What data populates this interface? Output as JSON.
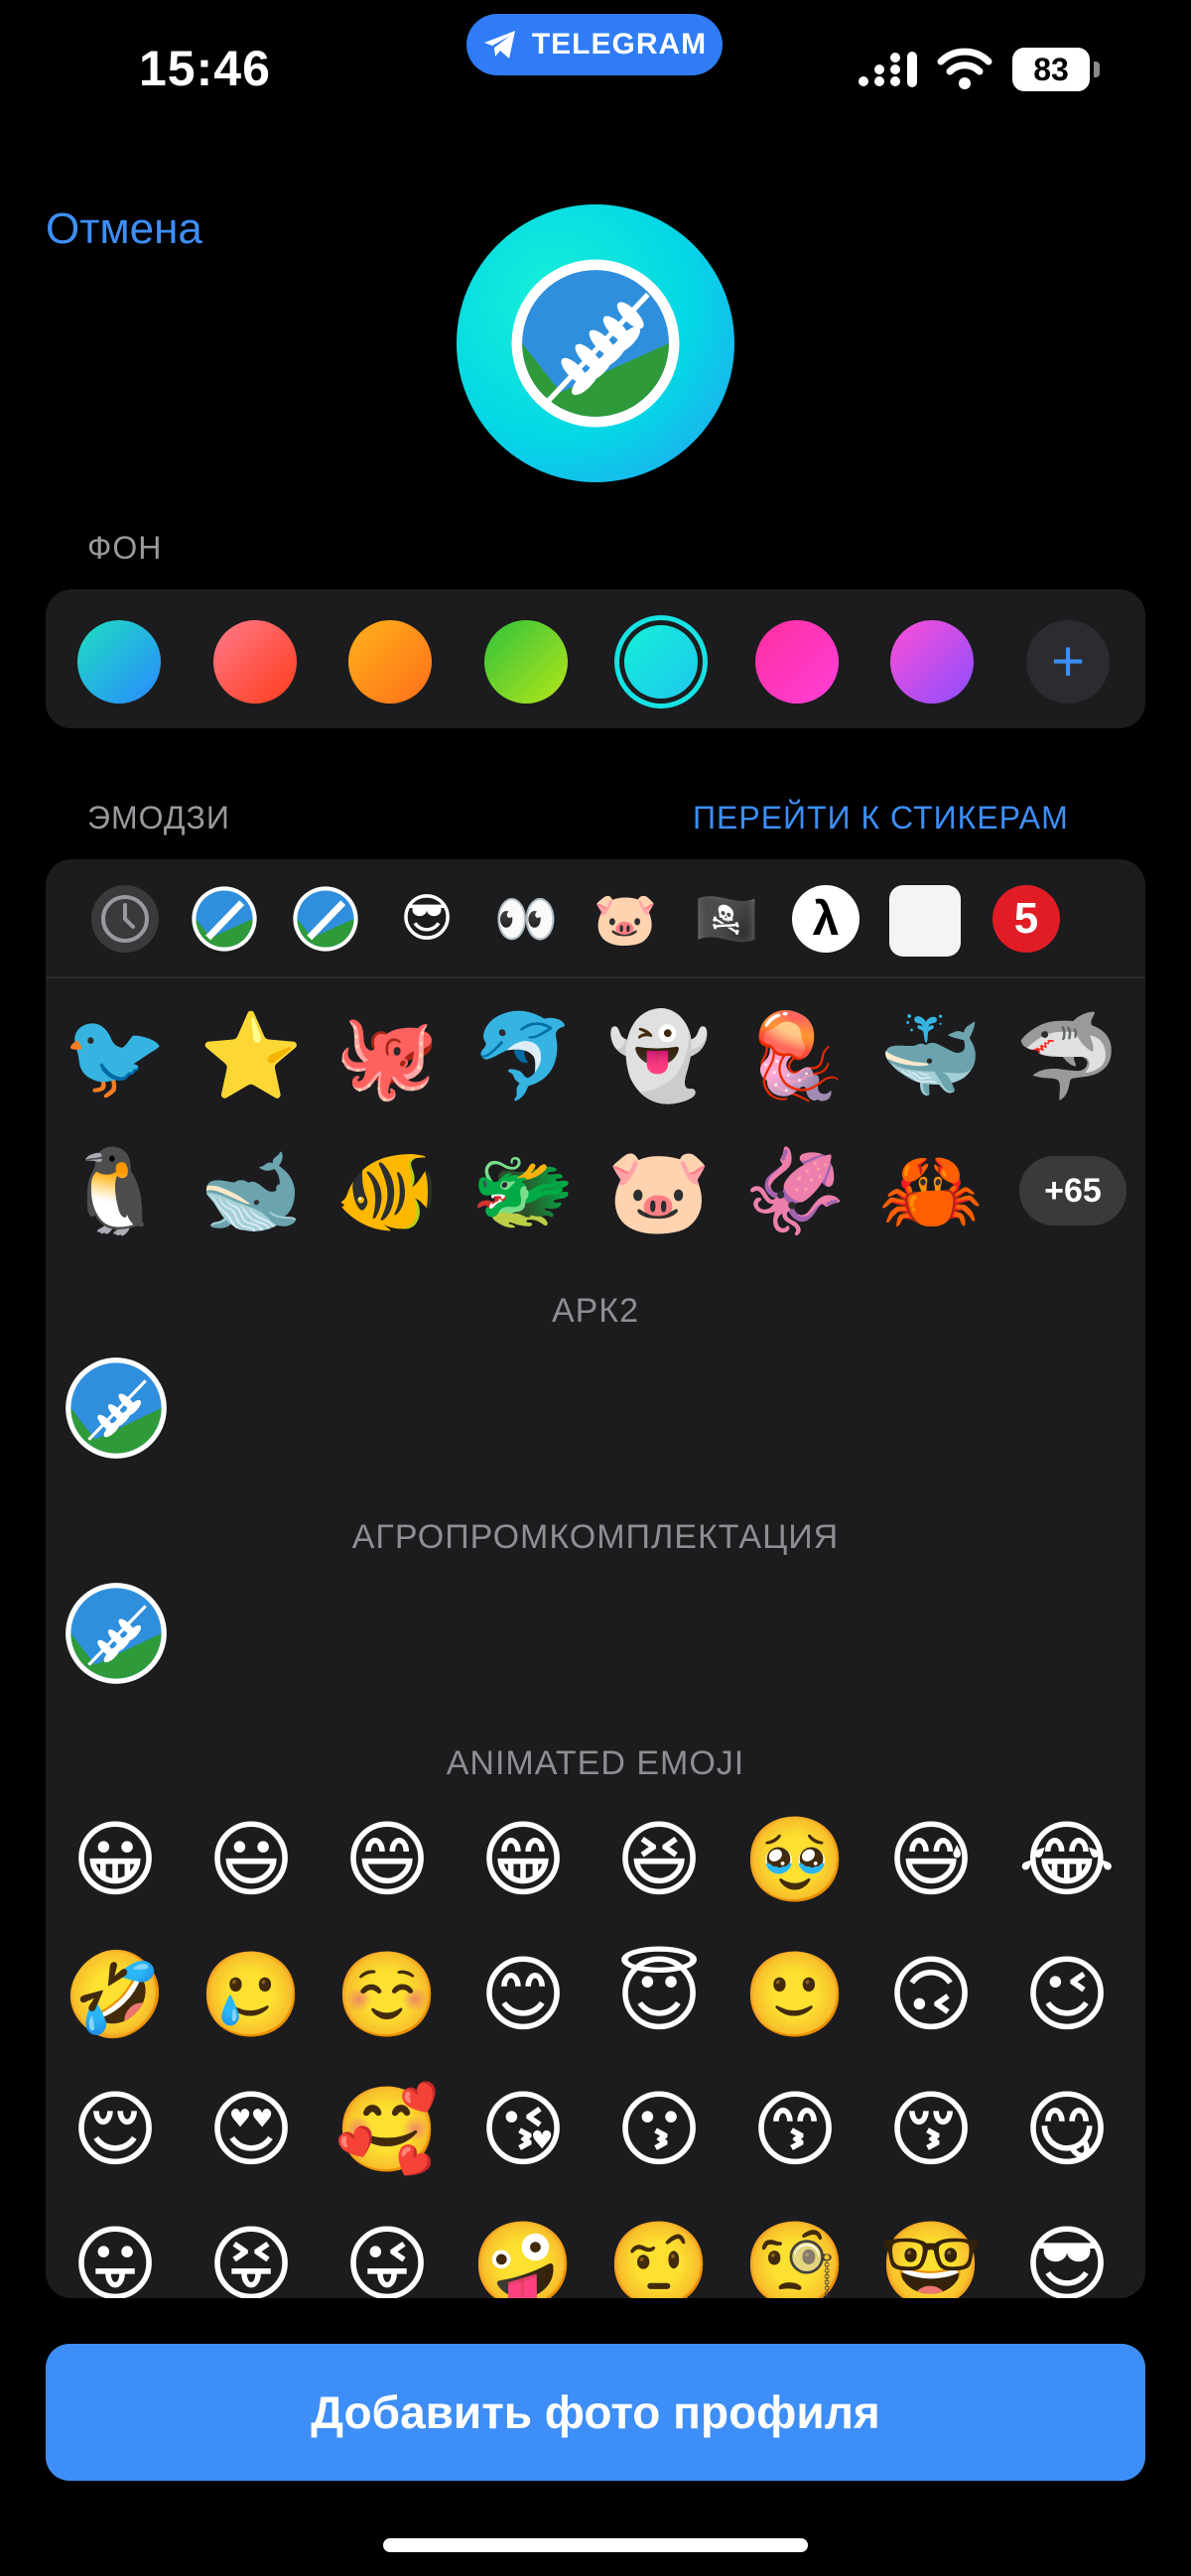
{
  "status_bar": {
    "time": "15:46",
    "app_pill": "TELEGRAM",
    "battery": "83"
  },
  "header": {
    "cancel_label": "Отмена"
  },
  "background_section": {
    "label": "ФОН",
    "swatches": [
      {
        "name": "teal-blue",
        "gradient": "linear-gradient(135deg,#1ee0c0,#2a88ff)"
      },
      {
        "name": "pink-red",
        "gradient": "linear-gradient(135deg,#ff7a8a,#ff3b1a)"
      },
      {
        "name": "orange",
        "gradient": "linear-gradient(135deg,#ffb21a,#ff6f1a)"
      },
      {
        "name": "green",
        "gradient": "linear-gradient(135deg,#2fc23a,#b6e61a)"
      },
      {
        "name": "cyan-selected",
        "gradient": "linear-gradient(135deg,#13f0d6,#1fc8f0)",
        "selected": true
      },
      {
        "name": "magenta",
        "gradient": "linear-gradient(135deg,#ff2fa0,#ff3fd8)"
      },
      {
        "name": "violet",
        "gradient": "linear-gradient(135deg,#ff4fd6,#8a4dff)"
      }
    ]
  },
  "emoji_section": {
    "label": "ЭМОДЗИ",
    "link": "ПЕРЕЙТИ К СТИКЕРАМ"
  },
  "tabs": [
    {
      "name": "tab-recent",
      "glyph": "🕓"
    },
    {
      "name": "tab-apk2",
      "glyph": ""
    },
    {
      "name": "tab-agro",
      "glyph": ""
    },
    {
      "name": "tab-cool",
      "glyph": "😎"
    },
    {
      "name": "tab-eyes",
      "glyph": "👀"
    },
    {
      "name": "tab-pig",
      "glyph": "🐷"
    },
    {
      "name": "tab-pirate",
      "glyph": "🏴‍☠️"
    },
    {
      "name": "tab-lambda",
      "glyph": "λ"
    },
    {
      "name": "tab-white",
      "glyph": ""
    },
    {
      "name": "tab-five",
      "glyph": "5"
    }
  ],
  "featured_rows": [
    [
      "🐦",
      "⭐",
      "🐙",
      "🐬",
      "👻",
      "🪼",
      "🐳",
      "🦈"
    ],
    [
      "🐧",
      "🐋",
      "🐠",
      "🐲",
      "🐷",
      "🦑",
      "🦀"
    ]
  ],
  "more_count": "+65",
  "groups": [
    {
      "title": "АРК2"
    },
    {
      "title": "АГРОПРОМКОМПЛЕКТАЦИЯ"
    },
    {
      "title": "ANIMATED EMOJI"
    }
  ],
  "animated_emoji_rows": [
    [
      "😀",
      "😃",
      "😄",
      "😁",
      "😆",
      "🥹",
      "😅",
      "😂"
    ],
    [
      "🤣",
      "🥲",
      "☺️",
      "😊",
      "😇",
      "🙂",
      "🙃",
      "😉"
    ],
    [
      "😌",
      "😍",
      "🥰",
      "😘",
      "😗",
      "😙",
      "😚",
      "😋"
    ],
    [
      "😛",
      "😝",
      "😜",
      "🤪",
      "🤨",
      "🧐",
      "🤓",
      "😎"
    ]
  ],
  "primary_button": "Добавить фото профиля",
  "colors": {
    "accent": "#3E8EF7",
    "panel": "#1c1c1e",
    "background": "#000000"
  }
}
